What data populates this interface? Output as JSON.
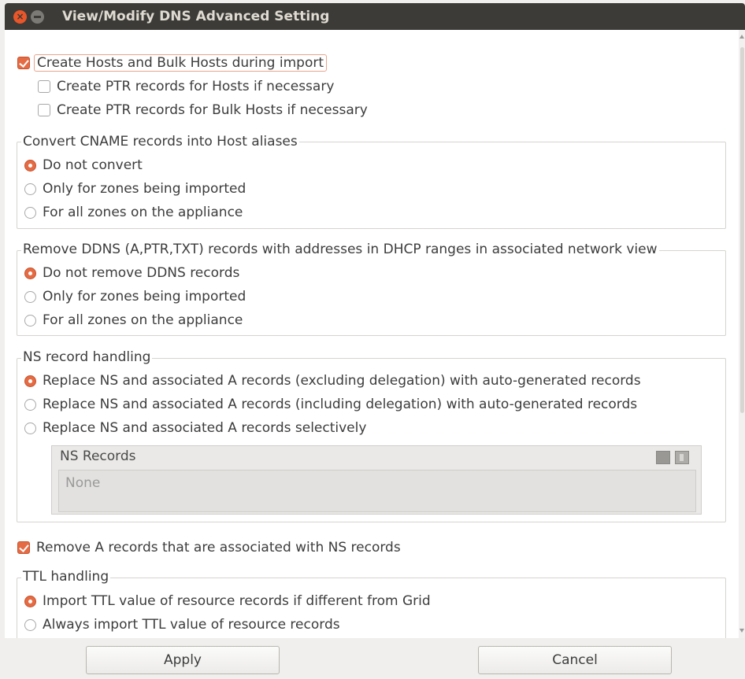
{
  "window": {
    "title": "View/Modify DNS Advanced Setting"
  },
  "create_hosts": {
    "label": "Create Hosts and Bulk Hosts during import",
    "checked": true,
    "ptr_hosts_label": "Create PTR records for Hosts if necessary",
    "ptr_bulk_label": "Create PTR records for Bulk Hosts if necessary"
  },
  "cname_group": {
    "legend": "Convert CNAME records into Host aliases",
    "options": [
      "Do not convert",
      "Only for zones being imported",
      "For all zones on the appliance"
    ],
    "selected": 0
  },
  "ddns_group": {
    "legend": "Remove DDNS (A,PTR,TXT) records with addresses in DHCP ranges in associated network view",
    "options": [
      "Do not remove DDNS records",
      "Only for zones being imported",
      "For all zones on the appliance"
    ],
    "selected": 0
  },
  "ns_group": {
    "legend": "NS record handling",
    "options": [
      "Replace NS and associated A records (excluding delegation) with auto-generated records",
      "Replace NS and associated A records (including delegation) with auto-generated records",
      "Replace NS and associated A records selectively"
    ],
    "selected": 0,
    "ns_records_title": "NS Records",
    "ns_records_empty": "None"
  },
  "remove_a": {
    "label": "Remove A records that are associated with NS records",
    "checked": true
  },
  "ttl_group": {
    "legend": "TTL handling",
    "options": [
      "Import TTL value of resource records if different from Grid",
      "Always import TTL value of resource records"
    ],
    "selected": 0
  },
  "footer": {
    "apply_label": "Apply",
    "cancel_label": "Cancel"
  },
  "colors": {
    "accent": "#e46b43",
    "titlebar": "#3c3b37"
  }
}
